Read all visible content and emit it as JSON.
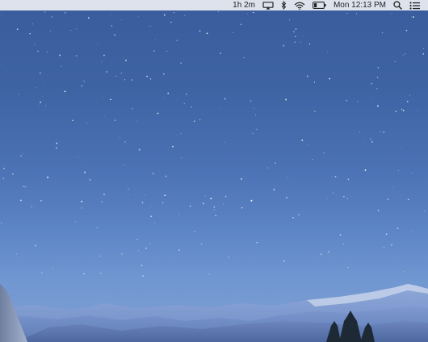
{
  "menubar": {
    "battery_time": "1h 2m",
    "clock": "Mon 12:13 PM",
    "icons": [
      "airplay-icon",
      "bluetooth-icon",
      "wifi-icon",
      "battery-icon",
      "spotlight-search-icon",
      "notification-center-icon"
    ]
  },
  "colors": {
    "sky_top": "#3a5c9c",
    "sky_bottom": "#7f9ed2",
    "menubar_bg": "#ebeef4"
  }
}
